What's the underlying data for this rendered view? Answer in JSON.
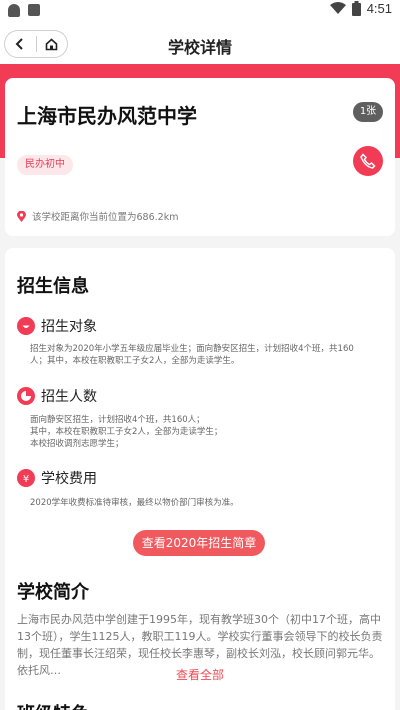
{
  "status_bar": {
    "time": "4:51"
  },
  "app_bar": {
    "title": "学校详情"
  },
  "school": {
    "name": "上海市民办风范中学",
    "photo_count": "1张",
    "tag": "民办初中",
    "distance": "该学校距离你当前位置为686.2km"
  },
  "enrollment": {
    "title": "招生信息",
    "target_label": "招生对象",
    "target_text": "招生对象为2020年小学五年级应届毕业生；面向静安区招生，计划招收4个班，共160人；其中，本校在职教职工子女2人，全部为走读学生。",
    "count_label": "招生人数",
    "count_lines": [
      "面向静安区招生，计划招收4个班，共160人；",
      "其中，本校在职教职工子女2人，全部为走读学生；",
      "本校招收调剂志愿学生；"
    ],
    "fee_label": "学校费用",
    "fee_text": "2020学年收费标准待审核，最终以物价部门审核为准。",
    "cta": "查看2020年招生简章"
  },
  "intro": {
    "title": "学校简介",
    "text": "上海市民办风范中学创建于1995年，现有教学班30个（初中17个班，高中13个班），学生1125人，教职工119人。学校实行董事会领导下的校长负责制，现任董事长汪绍荣，现任校长李惠琴，副校长刘泓，校长顾问郭元华。依托风…",
    "see_all": "查看全部"
  },
  "next_section": {
    "title": "班级特色"
  },
  "colors": {
    "brand": "#f23c55",
    "cta": "#f05a5f"
  }
}
